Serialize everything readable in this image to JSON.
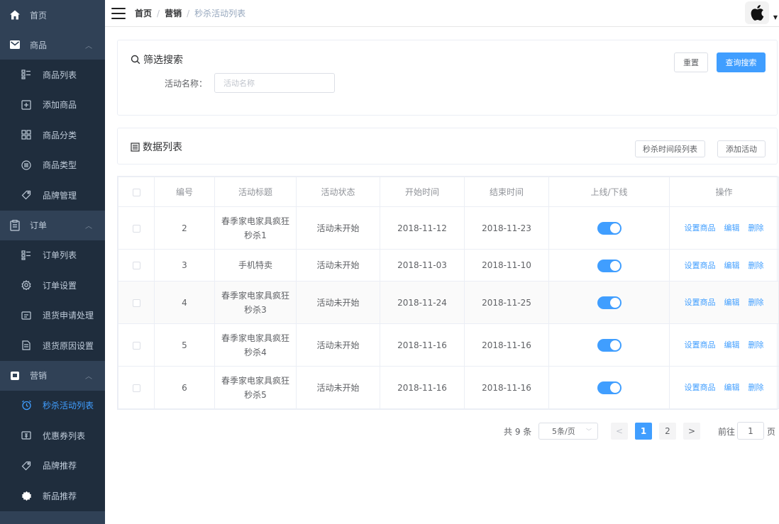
{
  "sidebar": {
    "home": "首页",
    "groups": [
      {
        "label": "商品",
        "items": [
          "商品列表",
          "添加商品",
          "商品分类",
          "商品类型",
          "品牌管理"
        ]
      },
      {
        "label": "订单",
        "items": [
          "订单列表",
          "订单设置",
          "退货申请处理",
          "退货原因设置"
        ]
      },
      {
        "label": "营销",
        "items": [
          "秒杀活动列表",
          "优惠券列表",
          "品牌推荐",
          "新品推荐"
        ]
      }
    ],
    "active_item": "秒杀活动列表",
    "colors": {
      "background": "#304156",
      "submenu": "#1f2d3d",
      "text": "#bfcbd9",
      "active": "#409eff"
    }
  },
  "navbar": {
    "breadcrumb": [
      "首页",
      "营销",
      "秒杀活动列表"
    ],
    "avatar_icon": "apple-icon"
  },
  "filter": {
    "title": "筛选搜索",
    "field_label": "活动名称：",
    "field_value": "",
    "field_placeholder": "活动名称",
    "reset_label": "重置",
    "search_label": "查询搜索"
  },
  "list": {
    "title": "数据列表",
    "time_list_button": "秒杀时间段列表",
    "add_button": "添加活动"
  },
  "table": {
    "columns": [
      "编号",
      "活动标题",
      "活动状态",
      "开始时间",
      "结束时间",
      "上线/下线",
      "操作"
    ],
    "rows": [
      {
        "id": "2",
        "title": "春季家电家具疯狂秒杀1",
        "status": "活动未开始",
        "start": "2018-11-12",
        "end": "2018-11-23",
        "online": true
      },
      {
        "id": "3",
        "title": "手机特卖",
        "status": "活动未开始",
        "start": "2018-11-03",
        "end": "2018-11-10",
        "online": true
      },
      {
        "id": "4",
        "title": "春季家电家具疯狂秒杀3",
        "status": "活动未开始",
        "start": "2018-11-24",
        "end": "2018-11-25",
        "online": true
      },
      {
        "id": "5",
        "title": "春季家电家具疯狂秒杀4",
        "status": "活动未开始",
        "start": "2018-11-16",
        "end": "2018-11-16",
        "online": true
      },
      {
        "id": "6",
        "title": "春季家电家具疯狂秒杀5",
        "status": "活动未开始",
        "start": "2018-11-16",
        "end": "2018-11-16",
        "online": true
      }
    ],
    "actions": [
      "设置商品",
      "编辑",
      "删除"
    ]
  },
  "pagination": {
    "total_text": "共 9 条",
    "page_size": "5条/页",
    "prev": "<",
    "pages": [
      "1",
      "2"
    ],
    "current_page": "1",
    "next": ">",
    "goto_label": "前往",
    "goto_value": "1",
    "goto_suffix": "页"
  }
}
